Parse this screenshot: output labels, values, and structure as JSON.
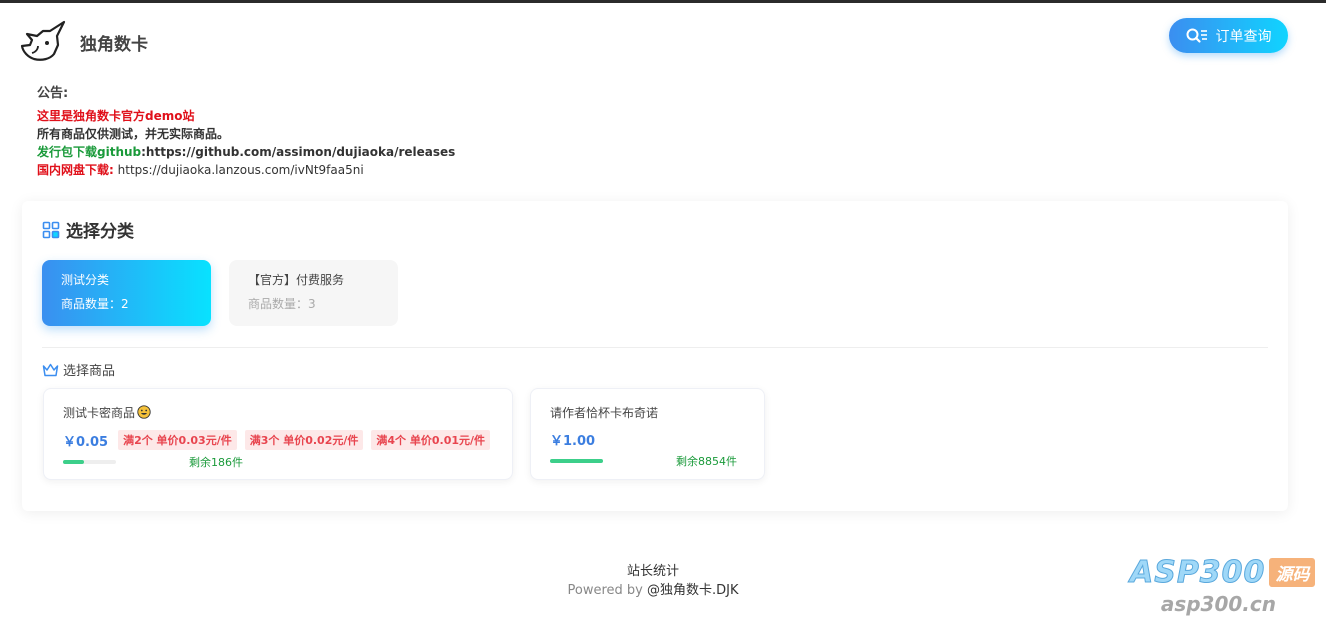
{
  "header": {
    "brand": "独角数卡",
    "order_button": "订单查询"
  },
  "notice": {
    "title": "公告:",
    "line1": "这里是独角数卡官方demo站",
    "line2": "所有商品仅供测试，并无实际商品。",
    "line3_label": "发行包下载github",
    "line3_value": ":https://github.com/assimon/dujiaoka/releases",
    "line4_label": "国内网盘下载:",
    "line4_value": " https://dujiaoka.lanzous.com/ivNt9faa5ni"
  },
  "categories": {
    "title": "选择分类",
    "items": [
      {
        "name": "测试分类",
        "count": "商品数量：2"
      },
      {
        "name": "【官方】付费服务",
        "count": "商品数量：3"
      }
    ]
  },
  "goods": {
    "title": "选择商品",
    "items": [
      {
        "name": "测试卡密商品",
        "price": "￥0.05",
        "tags": [
          "满2个 单价0.03元/件",
          "满3个 单价0.02元/件",
          "满4个 单价0.01元/件"
        ],
        "stock": "剩余186件",
        "stock_fraction": 0.4
      },
      {
        "name": "请作者恰杯卡布奇诺",
        "price": "￥1.00",
        "tags": [],
        "stock": "剩余8854件",
        "stock_fraction": 1.0
      }
    ]
  },
  "footer": {
    "stat": "站长统计",
    "powered_prefix": "Powered by ",
    "powered_name": "@独角数卡.DJK"
  },
  "watermark": {
    "brand": "ASP300",
    "badge": "源码",
    "url": "asp300.cn"
  },
  "colors": {
    "accent_start": "#3b8ef0",
    "accent_end": "#10d4ff",
    "price": "#3b7ee0",
    "tag_text": "#e8454f",
    "stock": "#1a9a3a",
    "bar": "#3ccf8a"
  }
}
